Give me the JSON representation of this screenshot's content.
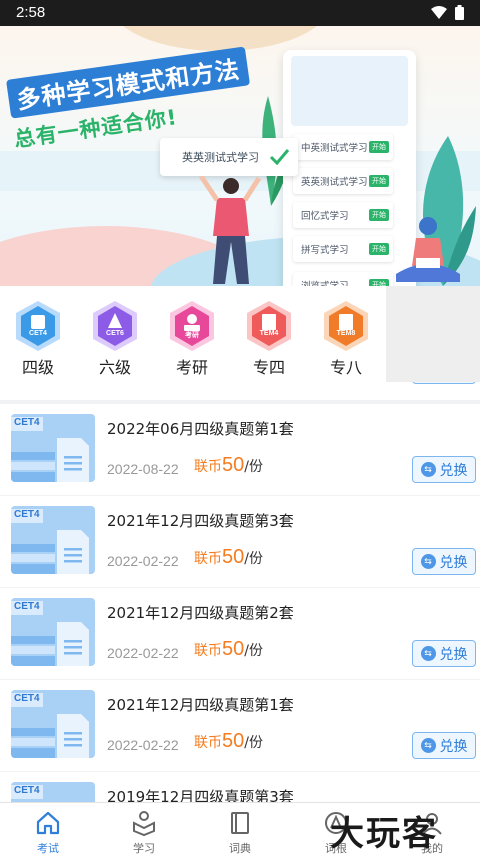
{
  "status_bar": {
    "time": "2:58"
  },
  "banner": {
    "headline": "多种学习模式和方法",
    "subheadline": "总有一种适合你!",
    "quiz_card": "英英测试式学习",
    "phone_modes": [
      "中英测试式学习",
      "英英测试式学习",
      "回忆式学习",
      "拼写式学习",
      "浏览式学习"
    ],
    "mode_button": "开始"
  },
  "categories": [
    {
      "badge": "CET4",
      "name": "四级",
      "color": "#3a9ae8"
    },
    {
      "badge": "CET6",
      "name": "六级",
      "color": "#8d5ce6"
    },
    {
      "badge": "考研",
      "name": "考研",
      "color": "#e8489a"
    },
    {
      "badge": "TEM4",
      "name": "专四",
      "color": "#ef5a5a"
    },
    {
      "badge": "TEM8",
      "name": "专八",
      "color": "#f07c2a"
    }
  ],
  "exam_list": {
    "thumb_tag": "CET4",
    "currency": "联币",
    "unit": "/份",
    "redeem_label": "兑换",
    "items": [
      {
        "title": "2022年06月四级真题第1套",
        "date": "2022-08-22",
        "price": "50"
      },
      {
        "title": "2021年12月四级真题第3套",
        "date": "2022-02-22",
        "price": "50"
      },
      {
        "title": "2021年12月四级真题第2套",
        "date": "2022-02-22",
        "price": "50"
      },
      {
        "title": "2021年12月四级真题第1套",
        "date": "2022-02-22",
        "price": "50"
      },
      {
        "title": "2019年12月四级真题第3套",
        "date": "",
        "price": ""
      }
    ]
  },
  "bottom_nav": [
    {
      "label": "考试",
      "icon": "home-icon",
      "active": true
    },
    {
      "label": "学习",
      "icon": "study-icon",
      "active": false
    },
    {
      "label": "词典",
      "icon": "dictionary-icon",
      "active": false
    },
    {
      "label": "词根",
      "icon": "word-root-icon",
      "active": false
    },
    {
      "label": "我的",
      "icon": "profile-icon",
      "active": false
    }
  ],
  "watermark": "大玩客",
  "colors": {
    "accent": "#2f7ed8",
    "price": "#f57c1f"
  }
}
